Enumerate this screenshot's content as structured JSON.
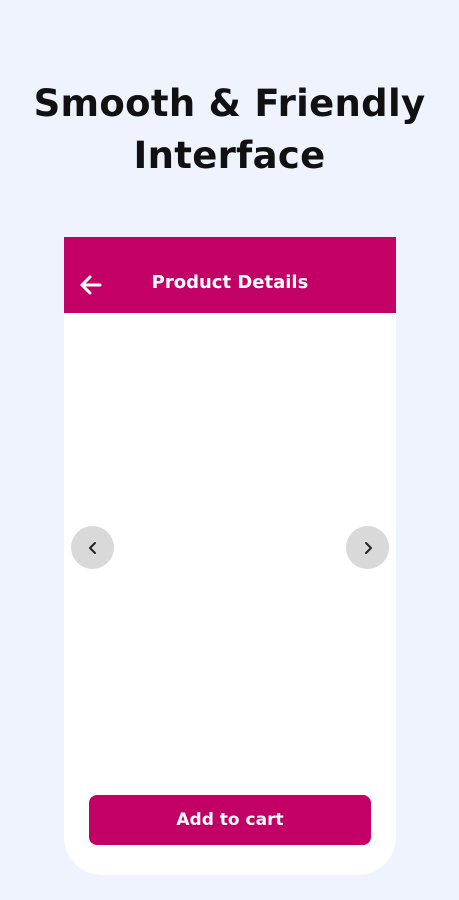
{
  "promo": {
    "headline_line1": "Smooth & Friendly",
    "headline_line2": "Interface"
  },
  "appbar": {
    "title": "Product Details",
    "back_icon": "arrow-left-icon",
    "background": "#c20066"
  },
  "gallery": {
    "prev_icon": "chevron-left-icon",
    "next_icon": "chevron-right-icon"
  },
  "actions": {
    "add_to_cart_label": "Add to cart",
    "accent": "#c20066"
  }
}
